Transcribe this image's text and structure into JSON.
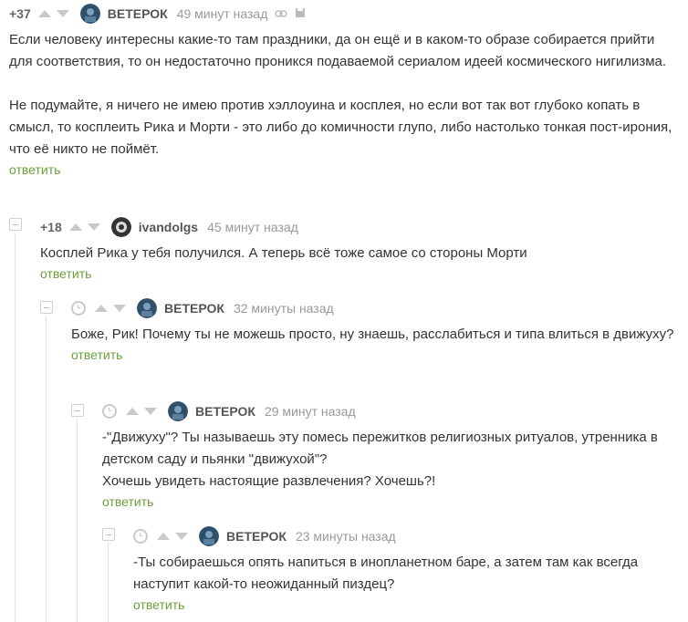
{
  "comments": [
    {
      "rating": "+37",
      "user": "ВЕТЕРОК",
      "time": "49 минут назад",
      "paragraphs": [
        "Если человеку интересны какие-то там праздники, да он ещё и в каком-то образе собирается прийти для соответствия, то он недостаточно проникся подаваемой сериалом идеей космического нигилизма.",
        "Не подумайте, я ничего не имею против хэллоуина и косплея, но если вот так вот глубоко копать в смысл, то косплеить Рика и Морти - это либо до комичности глупо, либо настолько тонкая пост-ирония, что её никто не поймёт."
      ],
      "reply": "ответить"
    },
    {
      "rating": "+18",
      "user": "ivandolgs",
      "time": "45 минут назад",
      "paragraphs": [
        "Косплей Рика у тебя получился. А теперь всё тоже самое со стороны Морти"
      ],
      "reply": "ответить"
    },
    {
      "user": "ВЕТЕРОК",
      "time": "32 минуты назад",
      "paragraphs": [
        "Боже, Рик! Почему ты не можешь просто, ну знаешь, расслабиться и типа влиться в движуху?"
      ],
      "reply": "ответить"
    },
    {
      "user": "ВЕТЕРОК",
      "time": "29 минут назад",
      "paragraphs": [
        "-\"Движуху\"? Ты называешь эту помесь пережитков религиозных ритуалов, утренника в детском саду и пьянки \"движухой\"?",
        "Хочешь увидеть настоящие развлечения? Хочешь?!"
      ],
      "reply": "ответить"
    },
    {
      "user": "ВЕТЕРОК",
      "time": "23 минуты назад",
      "paragraphs": [
        "-Ты собираешься опять напиться в инопланетном баре, а затем там как всегда наступит какой-то неожиданный пиздец?"
      ],
      "reply": "ответить"
    }
  ],
  "icons": {
    "link": "link-icon",
    "save": "save-icon",
    "collapse": "collapse-icon",
    "clock": "clock-icon",
    "avatar": "avatar"
  },
  "colors": {
    "reply": "#6b9e3c",
    "muted": "#999999",
    "arrow": "#c9c9c9"
  }
}
